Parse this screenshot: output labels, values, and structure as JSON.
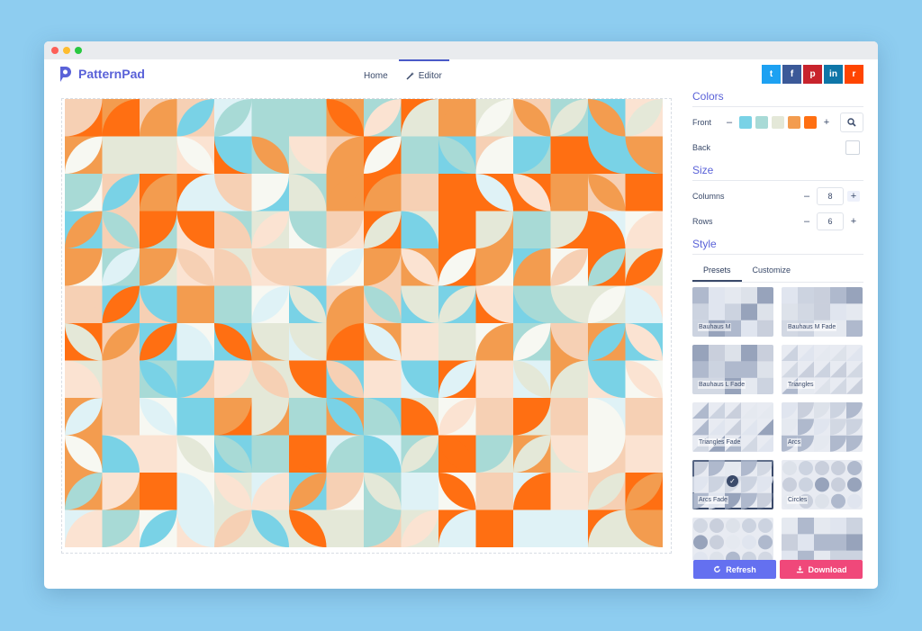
{
  "app": {
    "name": "PatternPad",
    "brand_color": "#5a62d8"
  },
  "nav": {
    "home": "Home",
    "editor": "Editor"
  },
  "share": [
    {
      "name": "twitter-icon",
      "glyph": "t",
      "color": "#1da1f2"
    },
    {
      "name": "facebook-icon",
      "glyph": "f",
      "color": "#3b5998"
    },
    {
      "name": "pinterest-icon",
      "glyph": "p",
      "color": "#c8232c"
    },
    {
      "name": "linkedin-icon",
      "glyph": "in",
      "color": "#0e76a8"
    },
    {
      "name": "reddit-icon",
      "glyph": "r",
      "color": "#ff4500"
    }
  ],
  "colors": {
    "title": "Colors",
    "front_label": "Front",
    "back_label": "Back",
    "minus": "–",
    "plus": "+",
    "front": [
      "#79d2e6",
      "#a8dad6",
      "#e4e8d8",
      "#f39c4f",
      "#ff6f12"
    ],
    "back": "#ffffff"
  },
  "size": {
    "title": "Size",
    "columns_label": "Columns",
    "columns": "8",
    "rows_label": "Rows",
    "rows": "6",
    "minus": "–",
    "plus": "+"
  },
  "style": {
    "title": "Style",
    "tabs": [
      "Presets",
      "Customize"
    ],
    "presets": [
      {
        "label": "Bauhaus M",
        "selected": false
      },
      {
        "label": "Bauhaus M Fade",
        "selected": false
      },
      {
        "label": "Bauhaus L Fade",
        "selected": false
      },
      {
        "label": "Triangles",
        "selected": false
      },
      {
        "label": "Triangles Fade",
        "selected": false
      },
      {
        "label": "Arcs",
        "selected": false
      },
      {
        "label": "Arcs Fade",
        "selected": true
      },
      {
        "label": "Circles",
        "selected": false
      },
      {
        "label": "",
        "selected": false
      },
      {
        "label": "",
        "selected": false
      }
    ]
  },
  "actions": {
    "refresh": "Refresh",
    "download": "Download",
    "refresh_color": "#6470f0",
    "download_color": "#f0487a"
  }
}
